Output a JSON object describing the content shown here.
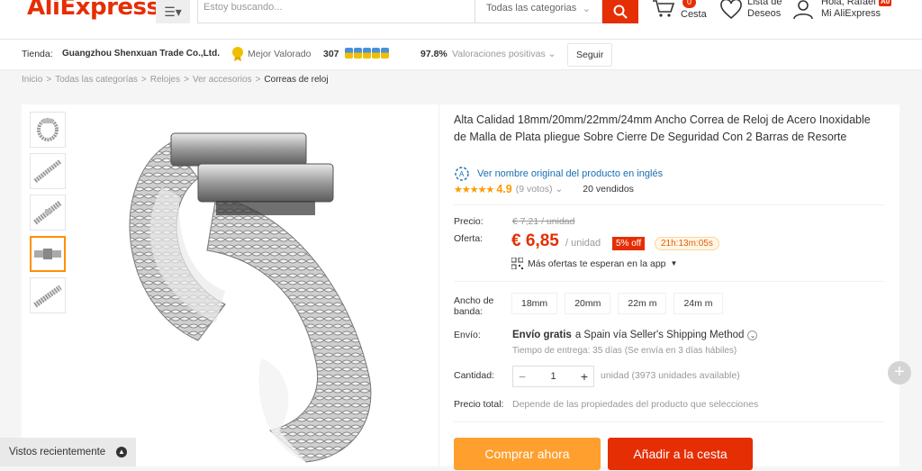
{
  "header": {
    "logo": "AliExpress",
    "search_placeholder": "Estoy buscando...",
    "category_select": "Todas las categorias",
    "cart_count": "0",
    "cart_label": "Cesta",
    "wishlist_line1": "Lista de",
    "wishlist_line2": "Deseos",
    "account_line1": "Hola, Rafael",
    "account_line2": "Mi AliExpress",
    "account_badge": "A0"
  },
  "store": {
    "label": "Tienda:",
    "name": "Guangzhou Shenxuan Trade Co.,Ltd.",
    "top_rated": "Mejor Valorado",
    "score": "307",
    "positive_pct": "97.8%",
    "positive_label": "Valoraciones positivas",
    "follow": "Seguir"
  },
  "breadcrumb": [
    "Inicio",
    "Todas las categorías",
    "Relojes",
    "Ver accesorios",
    "Correas de reloj"
  ],
  "product": {
    "title": "Alta Calidad 18mm/20mm/22mm/24mm Ancho Correa de Reloj de Acero Inoxidable de Malla de Plata pliegue Sobre Cierre De Seguridad Con 2 Barras de Resorte",
    "original_link": "Ver nombre original del producto en inglés",
    "stars": "★★★★★",
    "rating": "4.9",
    "votes": "(9 votos)",
    "sold": "20 vendidos"
  },
  "price": {
    "label_price": "Precio:",
    "old": "€ 7,21 / unidad",
    "label_offer": "Oferta:",
    "current": "€ 6,85",
    "unit": "/ unidad",
    "discount": "5% off",
    "timer": "21h:13m:05s",
    "app_offer": "Más ofertas te esperan en la app"
  },
  "options": {
    "band_label_1": "Ancho de",
    "band_label_2": "banda:",
    "sizes": [
      "18mm",
      "20mm",
      "22m m",
      "24m m"
    ]
  },
  "shipping": {
    "label": "Envío:",
    "free": "Envío gratis",
    "to": "a Spain vía Seller's Shipping Method",
    "delivery": "Tiempo de entrega: 35 días (Se envía en 3 días hábiles)"
  },
  "quantity": {
    "label": "Cantidad:",
    "value": "1",
    "note": "unidad (3973 unidades available)"
  },
  "total": {
    "label": "Precio total:",
    "note": "Depende de las propiedades del producto que selecciones"
  },
  "actions": {
    "buy_now": "Comprar ahora",
    "add_cart": "Añadir a la cesta"
  },
  "recently_viewed": "Vistos recientemente",
  "colors": {
    "brand_red": "#e62e04",
    "brand_orange": "#ff9f2e",
    "star": "#ff9900"
  }
}
